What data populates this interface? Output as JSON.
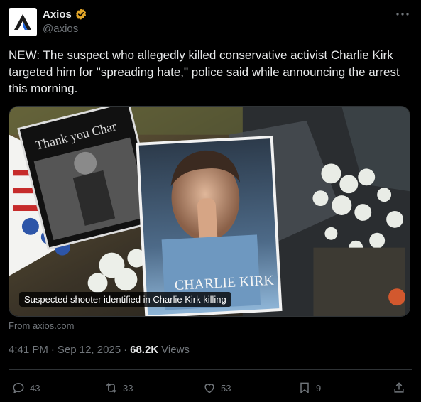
{
  "account": {
    "display_name": "Axios",
    "handle": "@axios",
    "verified_badge_color": "#e2a629",
    "avatar_icon": "axios-logo-icon"
  },
  "tweet": {
    "text": "NEW: The suspect who allegedly killed conservative activist Charlie Kirk targeted him for \"spreading hate,\" police said while announcing the arrest this morning."
  },
  "media": {
    "photo_caption_sign_header": "Thank you Char",
    "poster_text": "CHARLIE KIRK",
    "card_title": "Suspected shooter identified in Charlie Kirk killing",
    "source": "From axios.com"
  },
  "meta": {
    "time": "4:41 PM",
    "separator": "·",
    "date": "Sep 12, 2025",
    "views_count": "68.2K",
    "views_label": "Views"
  },
  "actions": {
    "replies": "43",
    "reposts": "33",
    "likes": "53",
    "bookmarks": "9"
  },
  "colors": {
    "background": "#000000",
    "text_primary": "#e7e9ea",
    "text_secondary": "#71767b",
    "border": "#2f3336"
  }
}
